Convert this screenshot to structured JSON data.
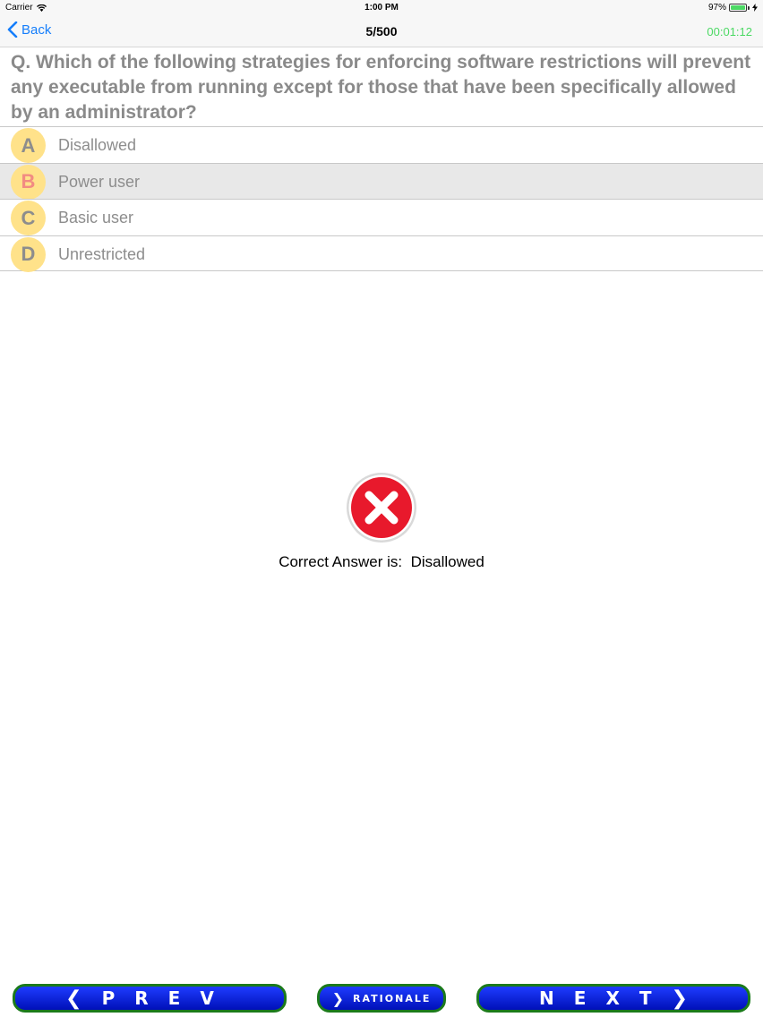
{
  "status_bar": {
    "carrier": "Carrier",
    "time": "1:00 PM",
    "battery_percent": "97%",
    "battery_level": 0.97
  },
  "nav": {
    "back_label": "Back",
    "title": "5/500",
    "timer": "00:01:12"
  },
  "question": {
    "text": "Q. Which of the following strategies for enforcing software restrictions will prevent any executable from running except for those that have been specifically allowed by an administrator?"
  },
  "options": [
    {
      "letter": "A",
      "text": "Disallowed"
    },
    {
      "letter": "B",
      "text": "Power user"
    },
    {
      "letter": "C",
      "text": "Basic user"
    },
    {
      "letter": "D",
      "text": "Unrestricted"
    }
  ],
  "selected_option": "B",
  "result": {
    "correct_answer_text": "Correct Answer is:  Disallowed",
    "icon": "x-circle-icon"
  },
  "buttons": {
    "prev_label": "PREV",
    "rationale_label": "RATIONALE",
    "next_label": "NEXT"
  },
  "colors": {
    "accent_blue": "#157efb",
    "timer_green": "#4cd964",
    "button_blue": "#0020e0",
    "button_border": "#1b7a1b",
    "letter_circle": "#ffe28a",
    "error_red": "#e8192c"
  }
}
